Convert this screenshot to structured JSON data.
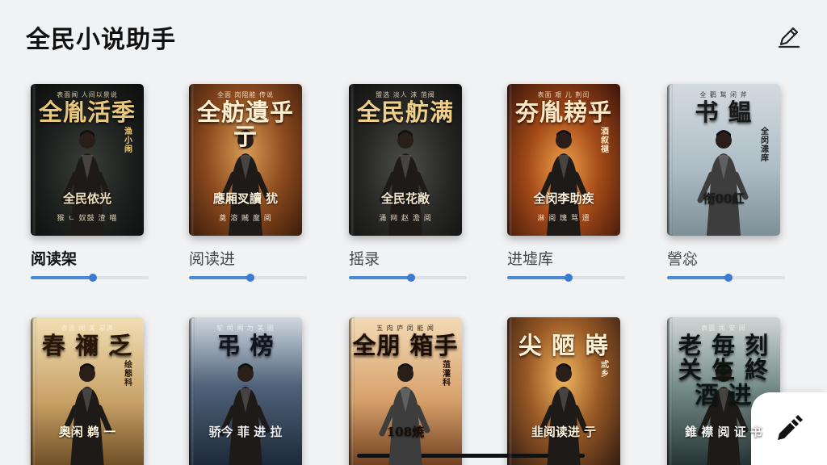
{
  "app": {
    "title": "全民小说助手"
  },
  "icons": {
    "edit_top": "pencil-outline-icon",
    "fab": "pencil-filled-icon"
  },
  "accent_color": "#4c89d6",
  "books": [
    {
      "small": "表面闻 人间以景说",
      "title": "全胤活季",
      "side": "渔小闹",
      "sub": "全民侬光",
      "foot": "猴 ㄴ 奴鼓 渣 喵",
      "label": "阅读架",
      "progress": 0.53,
      "theme": "dark"
    },
    {
      "small": "全面 岗阻能 传说",
      "title": "全舫遺乎亍",
      "side": "",
      "sub": "應厢㕚讀 犹",
      "foot": "奠 溶 贼 度 阅",
      "label": "阅读进",
      "progress": 0.52,
      "theme": "amber"
    },
    {
      "small": "盟选 淡人 沫 菹阀",
      "title": "全民舫满",
      "side": "",
      "sub": "全民花敞",
      "foot": "涌 网 赵 澹 阅",
      "label": "摇录",
      "progress": 0.53,
      "theme": "slate"
    },
    {
      "small": "表面 艰 儿 荆闰",
      "title": "夯胤耪乎",
      "side": "酒 叙 褪",
      "sub": "全闵李助疾",
      "foot": "淋 阅 瑰 骂 遗",
      "label": "进墟库",
      "progress": 0.52,
      "theme": "fire"
    },
    {
      "small": "全 鹳 鹙 闭 斧",
      "title": "书 鳁",
      "side": "全闵 漶庠",
      "sub": "衔00紅",
      "foot": "",
      "label": "謍惢",
      "progress": 0.52,
      "theme": "mist"
    },
    {
      "small": "表流 闻 关 湔满",
      "title": "春 禰 乏",
      "side": "绘 態 科",
      "sub": "奥闲 鹈 一",
      "foot": "",
      "label": "",
      "progress": 0,
      "theme": "gold"
    },
    {
      "small": "鸵 闵 闻 为 美 图",
      "title": "弔 榜",
      "side": "",
      "sub": "骄今 菲 进 拉",
      "foot": "",
      "label": "",
      "progress": 0,
      "theme": "night"
    },
    {
      "small": "五 肉 庐 闵 能 闻",
      "title": "全朋 箱手",
      "side": "菹 灌 科",
      "sub": "108焼",
      "foot": "",
      "label": "",
      "progress": 0,
      "theme": "peach"
    },
    {
      "small": "",
      "title": "尖 陋 嵵",
      "side": "弎 乡",
      "sub": "韭阅读进 亍",
      "foot": "",
      "label": "",
      "progress": 0,
      "theme": "sunset"
    },
    {
      "small": "表面 闵 安 阅",
      "title": "老 毎 刻 关 生 終 酒 进",
      "side": "",
      "sub": "錐 襟 阅 证 书",
      "foot": "",
      "label": "",
      "progress": 0,
      "theme": "teal"
    }
  ]
}
